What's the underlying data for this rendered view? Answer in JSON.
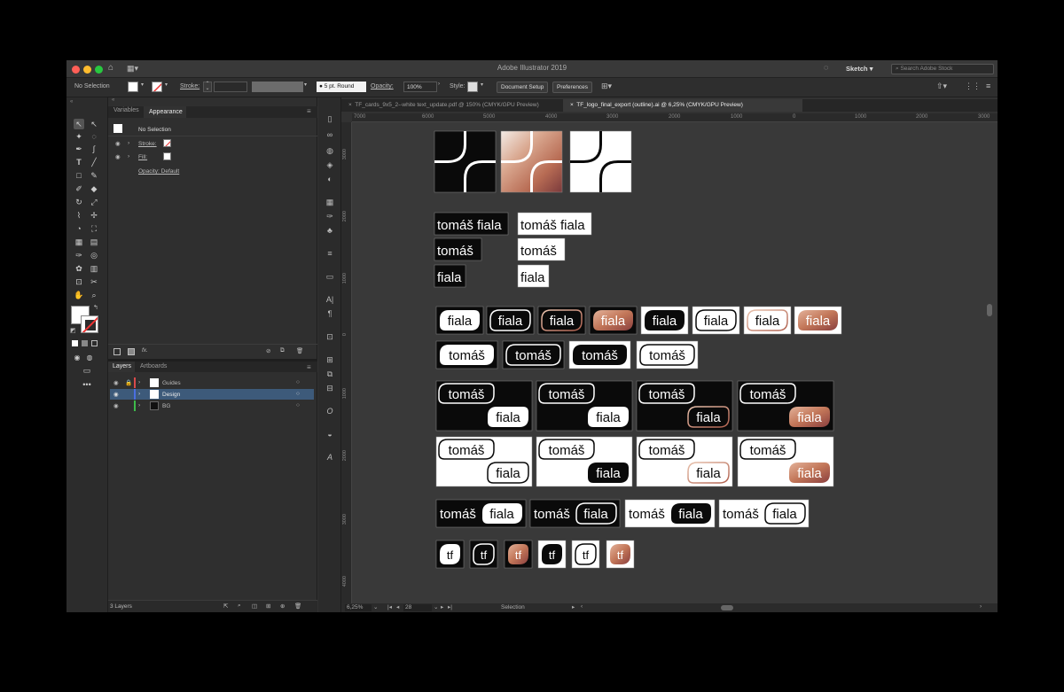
{
  "window": {
    "title": "Adobe Illustrator 2019",
    "workspace": "Sketch",
    "search_placeholder": "Search Adobe Stock"
  },
  "control_bar": {
    "selection": "No Selection",
    "stroke_label": "Stroke:",
    "brush": "5 pt. Round",
    "opacity_label": "Opacity:",
    "opacity_value": "100%",
    "style_label": "Style:",
    "document_setup": "Document Setup",
    "preferences": "Preferences"
  },
  "appearance_panel": {
    "tabs": [
      "Variables",
      "Appearance"
    ],
    "header": "No Selection",
    "stroke_label": "Stroke:",
    "fill_label": "Fill:",
    "opacity_row": "Opacity: Default"
  },
  "layers_panel": {
    "tabs": [
      "Layers",
      "Artboards"
    ],
    "layers": [
      {
        "name": "Guides",
        "color": "#d94a4a"
      },
      {
        "name": "Design",
        "color": "#4a6fe0"
      },
      {
        "name": "BG",
        "color": "#3dbb4a"
      }
    ],
    "count": "3 Layers"
  },
  "doc_tabs": [
    "TF_cards_9x5_2--white text_update.pdf @ 150% (CMYK/GPU Preview)",
    "TF_logo_final_export (outline).ai @ 6,25% (CMYK/GPU Preview)"
  ],
  "h_ruler": [
    "7000",
    "6000",
    "5000",
    "4000",
    "3000",
    "2000",
    "1000",
    "0",
    "1000",
    "2000",
    "3000"
  ],
  "v_ruler": [
    "3000",
    "2000",
    "1000",
    "0",
    "1000",
    "2000",
    "3000",
    "4000"
  ],
  "status": {
    "zoom": "6,25%",
    "artboard": "28",
    "tool": "Selection"
  },
  "artwork": {
    "wordmark_full": "tomáš fiala",
    "wordmark_first": "tomáš",
    "wordmark_last": "fiala",
    "monogram": "tf"
  },
  "colors": {
    "accent": "#c98062",
    "dark": "#0a0a0a",
    "panel": "#323232",
    "selection": "#3d5a7a"
  }
}
